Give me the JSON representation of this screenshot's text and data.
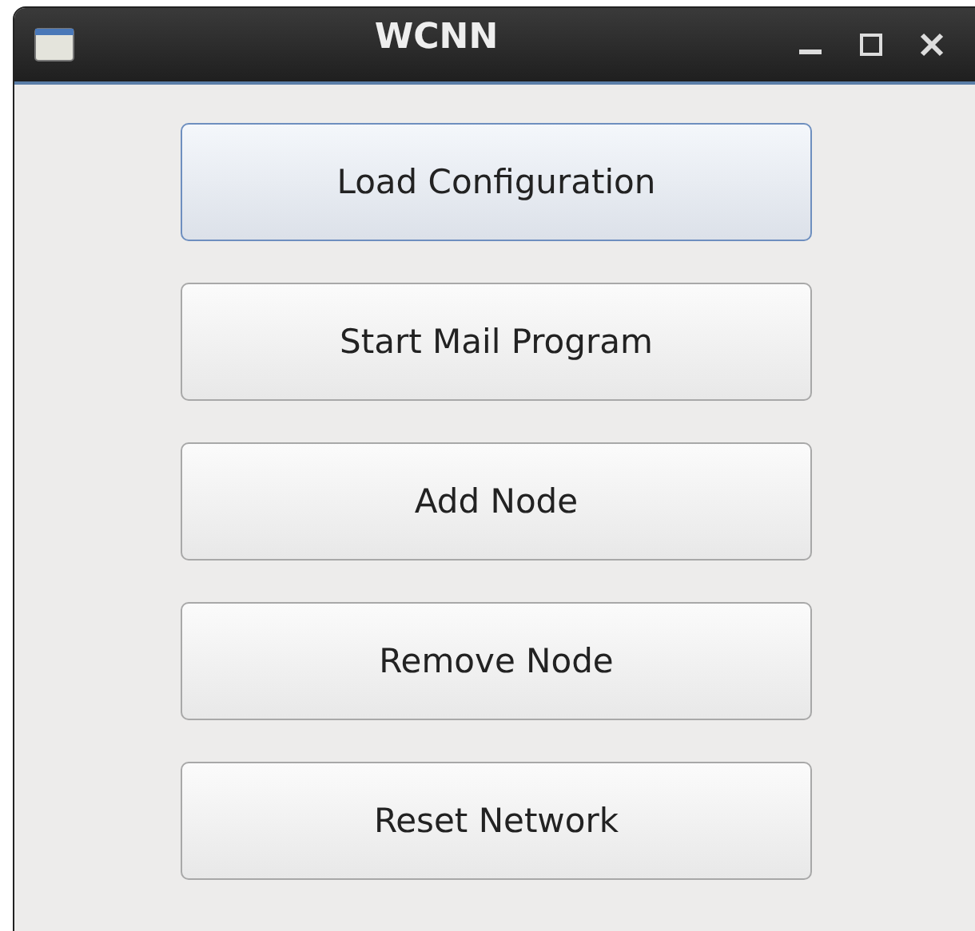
{
  "window": {
    "title": "WCNN"
  },
  "buttons": [
    {
      "label": "Load Configuration",
      "focused": true
    },
    {
      "label": "Start Mail Program",
      "focused": false
    },
    {
      "label": "Add Node",
      "focused": false
    },
    {
      "label": "Remove Node",
      "focused": false
    },
    {
      "label": "Reset Network",
      "focused": false
    }
  ]
}
